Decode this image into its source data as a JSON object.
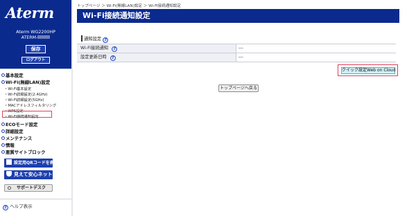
{
  "brand": {
    "logo_text": "Aterm",
    "model_line1": "Aterm  WG2200HP",
    "model_line2": "ATERM-"
  },
  "sidebar": {
    "save_label": "保存",
    "logout_label": "ログアウト",
    "categories": {
      "basic": "基本設定",
      "wifi": "Wi-Fi(無線LAN)設定",
      "eco": "ECOモード設定",
      "detail": "詳細設定",
      "maint": "メンテナンス",
      "info": "情報",
      "malicious": "悪質サイトブロック"
    },
    "wifi_items": [
      "Wi-Fi基本設定",
      "Wi-Fi詳細設定(2.4GHz)",
      "Wi-Fi詳細設定(5GHz)",
      "MACアドレスフィルタリング",
      "WPS設定",
      "Wi-Fi接続通知設定"
    ],
    "qr_button": "設定用QRコードを表示",
    "mieru_button": "見えて安心ネット",
    "support_button": "サポートデスク",
    "help_label": "ヘルプ表示"
  },
  "main": {
    "breadcrumb": "トップページ ＞ Wi-Fi(無線LAN)設定 ＞ Wi-Fi接続通知設定",
    "title": "Wi-Fi接続通知設定",
    "section_label": "通知設定",
    "rows": [
      {
        "label": "Wi-Fi接続通知",
        "value": "---"
      },
      {
        "label": "設定更新日時",
        "value": "---"
      }
    ],
    "cloud_button": "クイック設定Web on Cloud",
    "top_button": "トップページへ戻る"
  },
  "colors": {
    "brand_navy": "#0a2a8e",
    "highlight_red": "#d9435a",
    "cloud_button_bg": "#cfeef6"
  },
  "icons": [
    "help-icon",
    "category-dot-icon",
    "qr-icon",
    "shield-icon",
    "support-circle-icon"
  ]
}
